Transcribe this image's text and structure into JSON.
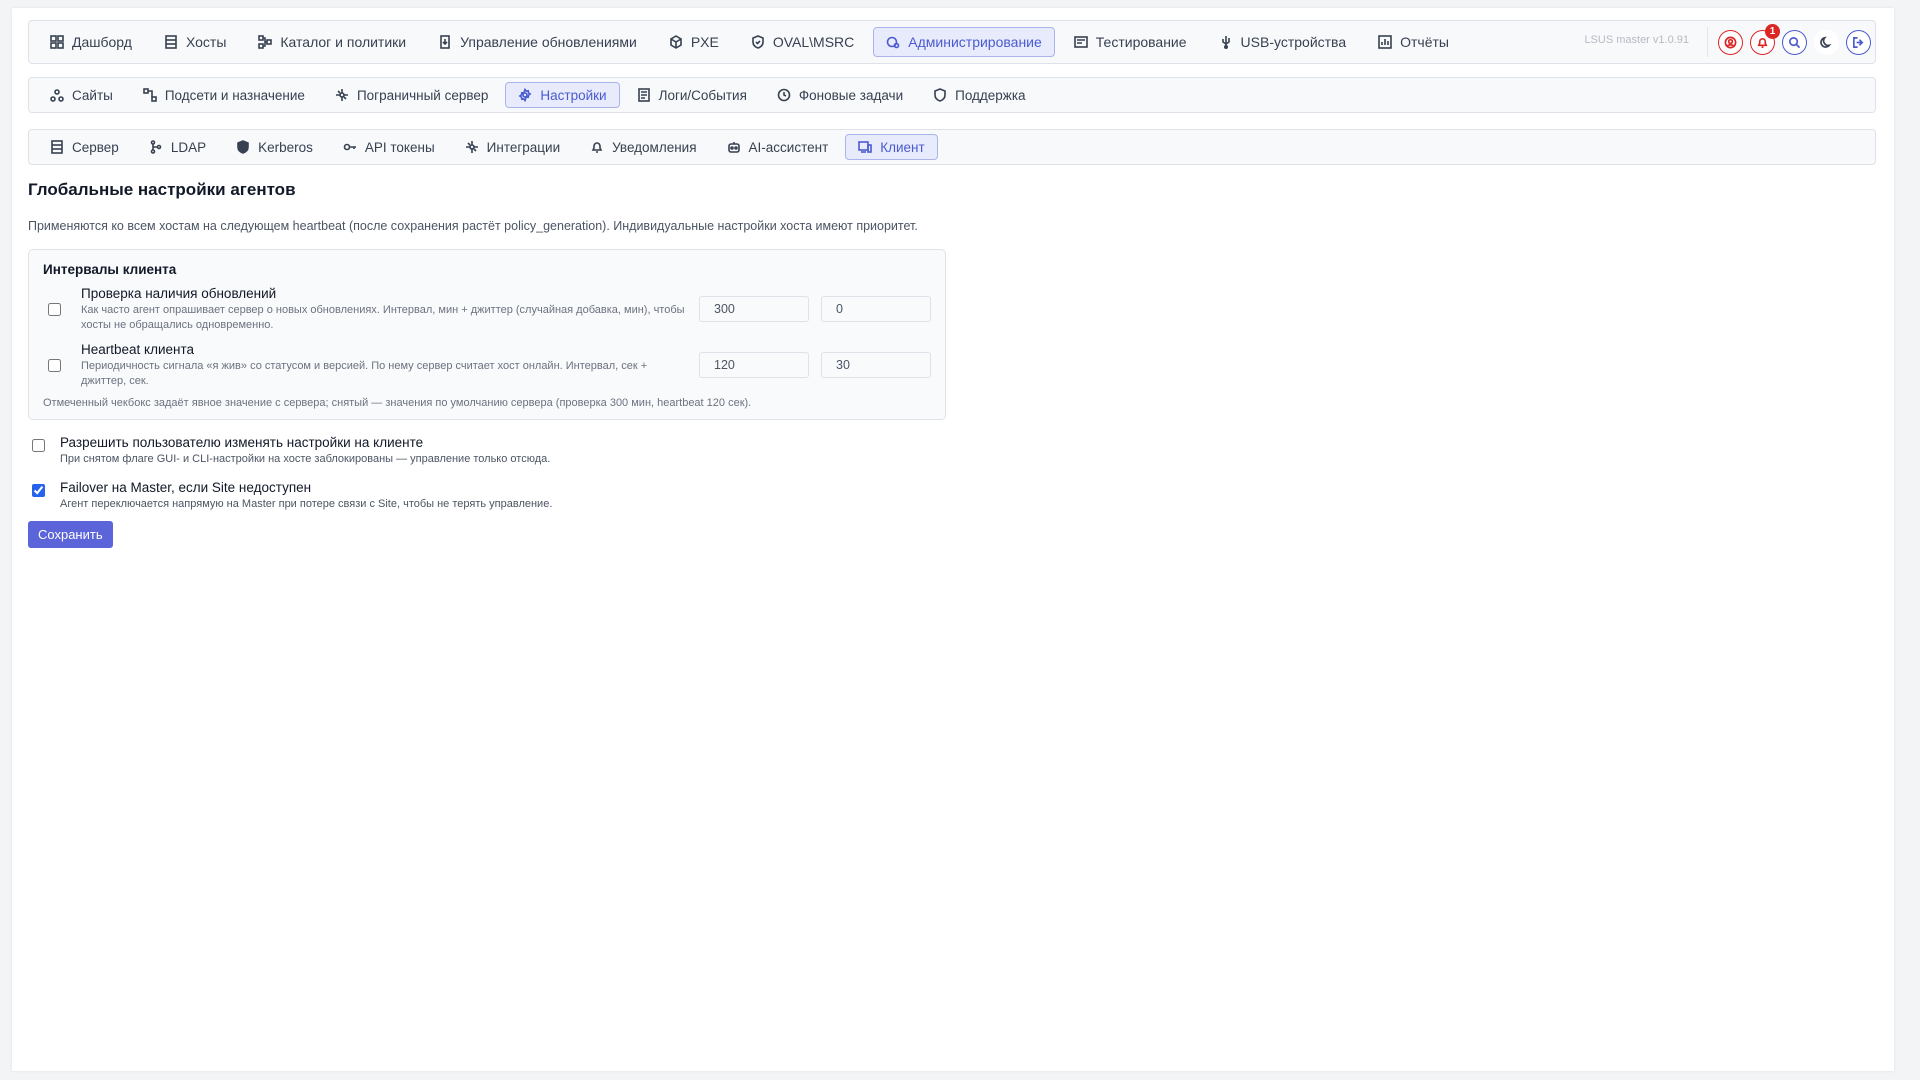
{
  "topnav": {
    "tabs": [
      {
        "label": "Дашборд",
        "icon": "dashboard-icon"
      },
      {
        "label": "Хосты",
        "icon": "server-icon"
      },
      {
        "label": "Каталог и политики",
        "icon": "catalog-icon"
      },
      {
        "label": "Управление обновлениями",
        "icon": "update-icon"
      },
      {
        "label": "PXE",
        "icon": "cube-icon"
      },
      {
        "label": "OVAL\\MSRC",
        "icon": "shield-check-icon"
      },
      {
        "label": "Администрирование",
        "icon": "admin-gear-icon",
        "active": true
      },
      {
        "label": "Тестирование",
        "icon": "test-icon"
      },
      {
        "label": "USB-устройства",
        "icon": "usb-icon"
      },
      {
        "label": "Отчёты",
        "icon": "report-icon"
      }
    ],
    "version": "LSUS master v1.0.91",
    "notification_count": "1"
  },
  "subnav": {
    "tabs": [
      {
        "label": "Сайты",
        "icon": "sites-icon"
      },
      {
        "label": "Подсети и назначение",
        "icon": "subnet-icon"
      },
      {
        "label": "Пограничный сервер",
        "icon": "edge-server-icon"
      },
      {
        "label": "Настройки",
        "icon": "settings-icon",
        "active": true
      },
      {
        "label": "Логи/События",
        "icon": "log-icon"
      },
      {
        "label": "Фоновые задачи",
        "icon": "clock-icon"
      },
      {
        "label": "Поддержка",
        "icon": "support-icon"
      }
    ]
  },
  "settingsnav": {
    "tabs": [
      {
        "label": "Сервер",
        "icon": "server-icon"
      },
      {
        "label": "LDAP",
        "icon": "ldap-icon"
      },
      {
        "label": "Kerberos",
        "icon": "kerberos-icon"
      },
      {
        "label": "API токены",
        "icon": "key-icon"
      },
      {
        "label": "Интеграции",
        "icon": "integrations-icon"
      },
      {
        "label": "Уведомления",
        "icon": "bell-icon"
      },
      {
        "label": "AI-ассистент",
        "icon": "robot-icon"
      },
      {
        "label": "Клиент",
        "icon": "client-icon",
        "active": true
      }
    ]
  },
  "page": {
    "title": "Глобальные настройки агентов",
    "description": "Применяются ко всем хостам на следующем heartbeat (после сохранения растёт policy_generation). Индивидуальные настройки хоста имеют приоритет."
  },
  "intervals": {
    "title": "Интервалы клиента",
    "rows": [
      {
        "title": "Проверка наличия обновлений",
        "help": "Как часто агент опрашивает сервер о новых обновлениях. Интервал, мин + джиттер (случайная добавка, мин), чтобы хосты не обращались одновременно.",
        "interval": "300",
        "jitter": "0",
        "checked": false
      },
      {
        "title": "Heartbeat клиента",
        "help": "Периодичность сигнала «я жив» со статусом и версией. По нему сервер считает хост онлайн. Интервал, сек + джиттер, сек.",
        "interval": "120",
        "jitter": "30",
        "checked": false
      }
    ],
    "note": "Отмеченный чекбокс задаёт явное значение с сервера; снятый — значения по умолчанию сервера (проверка 300 мин, heartbeat 120 сек)."
  },
  "options": [
    {
      "title": "Разрешить пользователю изменять настройки на клиенте",
      "help": "При снятом флаге GUI- и CLI-настройки на хосте заблокированы — управление только отсюда.",
      "checked": false
    },
    {
      "title": "Failover на Master, если Site недоступен",
      "help": "Агент переключается напрямую на Master при потере связи с Site, чтобы не терять управление.",
      "checked": true
    }
  ],
  "save_label": "Сохранить",
  "colors": {
    "accent": "#4a5bd1",
    "button": "#5b64d8",
    "danger": "#dc2626"
  }
}
